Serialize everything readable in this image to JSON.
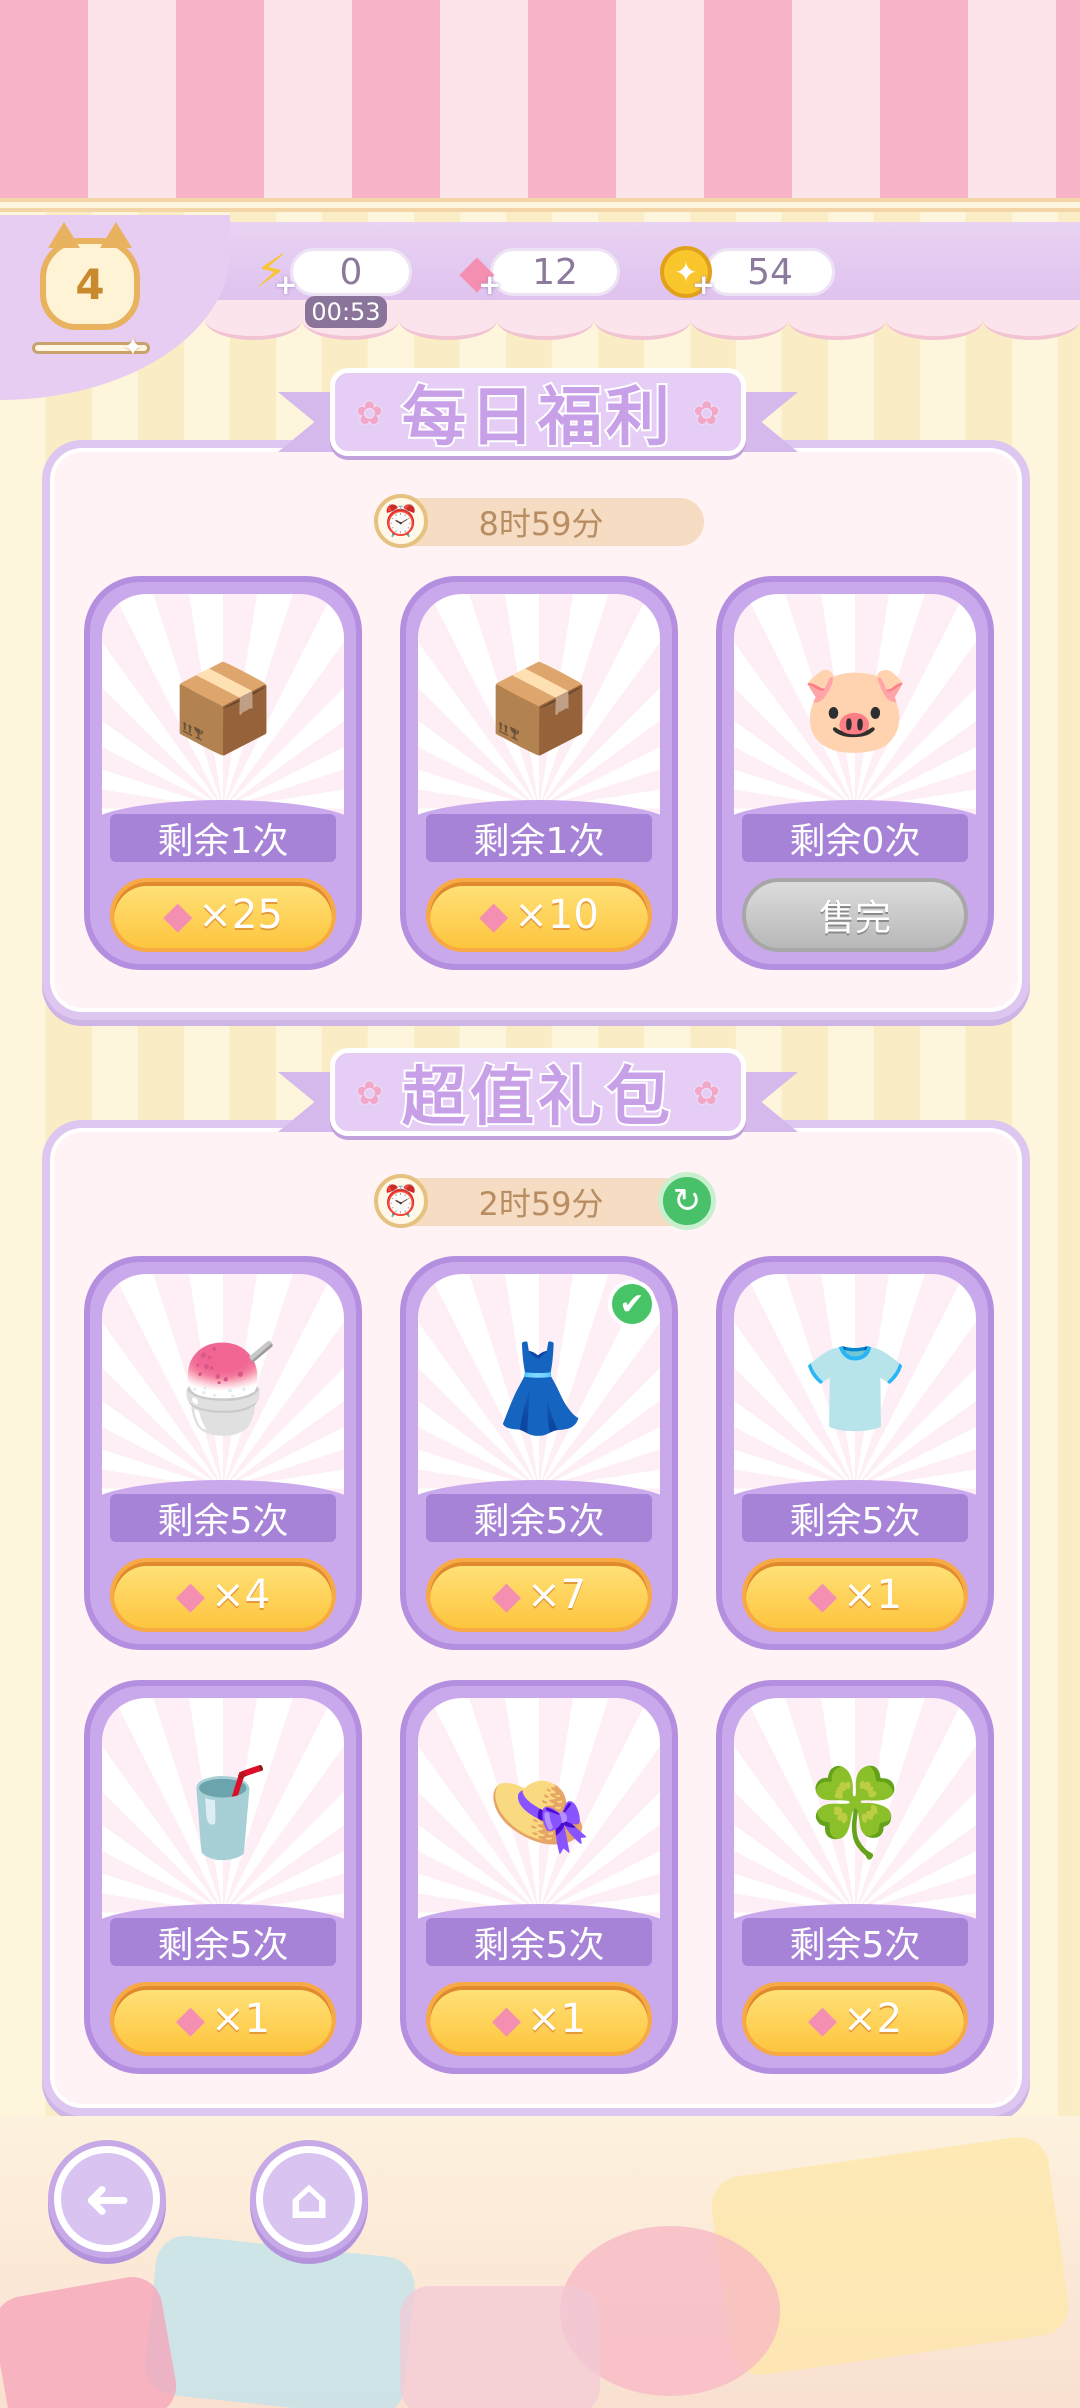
{
  "header": {
    "level": "4",
    "energy": {
      "value": "0",
      "timer": "00:53",
      "icon": "lightning-icon"
    },
    "gems": {
      "value": "12",
      "icon": "gem-icon"
    },
    "coins": {
      "value": "54",
      "icon": "coin-icon"
    }
  },
  "daily": {
    "title": "每日福利",
    "countdown": "8时59分",
    "items": [
      {
        "icon": "box-with-coin-icon",
        "glyph": "📦",
        "remain": "剩余1次",
        "price": "×25",
        "sold_out": false
      },
      {
        "icon": "box-with-energy-icon",
        "glyph": "📦",
        "remain": "剩余1次",
        "price": "×10",
        "sold_out": false
      },
      {
        "icon": "piggy-bank-icon",
        "glyph": "🐷",
        "remain": "剩余0次",
        "sold_out": true,
        "sold_label": "售完"
      }
    ]
  },
  "bundle": {
    "title": "超值礼包",
    "countdown": "2时59分",
    "items": [
      {
        "icon": "strawberry-parfait-icon",
        "glyph": "🍧",
        "remain": "剩余5次",
        "price": "×4"
      },
      {
        "icon": "pink-dress-icon",
        "glyph": "👗",
        "remain": "剩余5次",
        "price": "×7",
        "owned": true
      },
      {
        "icon": "green-outfit-icon",
        "glyph": "👕",
        "remain": "剩余5次",
        "price": "×1"
      },
      {
        "icon": "iced-tea-icon",
        "glyph": "🥤",
        "remain": "剩余5次",
        "price": "×1"
      },
      {
        "icon": "pink-hat-icon",
        "glyph": "👒",
        "remain": "剩余5次",
        "price": "×1"
      },
      {
        "icon": "flower-hairpin-icon",
        "glyph": "🍀",
        "remain": "剩余5次",
        "price": "×2"
      }
    ]
  },
  "nav": {
    "back_icon": "back-arrow-icon",
    "home_icon": "home-icon"
  },
  "colors": {
    "accent": "#c9a9ec",
    "gold": "#fdc53e",
    "gem": "#f58fb2",
    "stripe_pink": "#f7b4c8"
  }
}
